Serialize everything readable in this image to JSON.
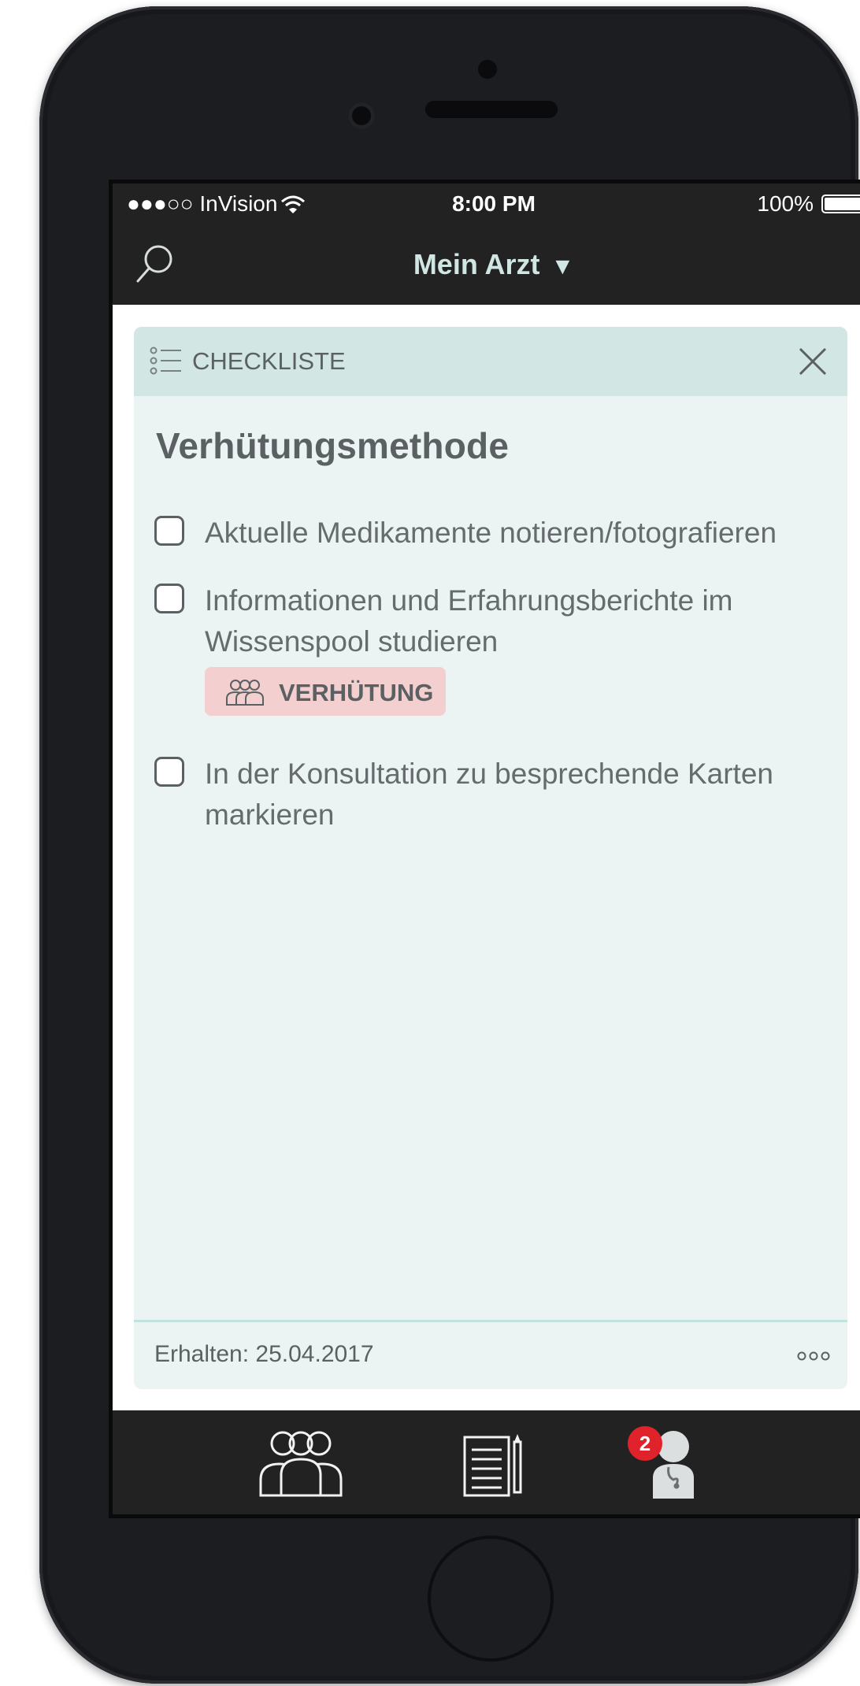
{
  "status_bar": {
    "carrier": "●●●○○ InVision",
    "time": "8:00 PM",
    "battery": "100%"
  },
  "nav": {
    "title": "Mein Arzt",
    "caret": "▼",
    "search_icon": "search-icon"
  },
  "card": {
    "header_label": "CHECKLISTE",
    "title": "Verhütungsmethode",
    "items": [
      {
        "text": "Aktuelle Medikamente notieren/fotografieren",
        "checked": false
      },
      {
        "text": "Informationen und Erfahrungsberichte im Wissenspool studieren",
        "checked": false
      },
      {
        "text": "In der Konsultation zu besprechende Karten markieren",
        "checked": false
      }
    ],
    "tag": {
      "label": "VERHÜTUNG",
      "icon": "group-icon"
    },
    "footer": {
      "date": "Erhalten: 25.04.2017",
      "more": "more-icon"
    }
  },
  "tabbar": {
    "tabs": [
      {
        "name": "community",
        "icon": "group-icon"
      },
      {
        "name": "notes",
        "icon": "notepad-icon"
      },
      {
        "name": "doctor",
        "icon": "doctor-icon",
        "badge": "2"
      }
    ]
  },
  "colors": {
    "bar_dark": "#222222",
    "card_bg": "#ebf4f2",
    "card_header_bg": "#d2e7e4",
    "tag_bg": "#f4cfcf",
    "badge_red": "#e0232a",
    "nav_title": "#cfe6e3"
  }
}
